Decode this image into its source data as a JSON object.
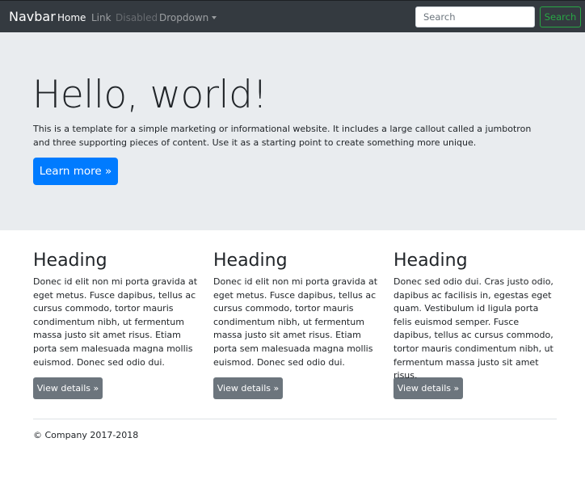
{
  "navbar": {
    "brand": "Navbar",
    "items": [
      {
        "label": "Home",
        "state": "active"
      },
      {
        "label": "Link",
        "state": "normal"
      },
      {
        "label": "Disabled",
        "state": "disabled"
      },
      {
        "label": "Dropdown",
        "state": "dropdown"
      }
    ],
    "search_placeholder": "Search",
    "search_button": "Search"
  },
  "jumbotron": {
    "title": "Hello, world!",
    "text": "This is a template for a simple marketing or informational website. It includes a large callout called a jumbotron and three supporting pieces of content. Use it as a starting point to create something more unique.",
    "button": "Learn more »"
  },
  "columns": [
    {
      "heading": "Heading",
      "text": "Donec id elit non mi porta gravida at eget metus. Fusce dapibus, tellus ac cursus commodo, tortor mauris condimentum nibh, ut fermentum massa justo sit amet risus. Etiam porta sem malesuada magna mollis euismod. Donec sed odio dui.",
      "button": "View details »"
    },
    {
      "heading": "Heading",
      "text": "Donec id elit non mi porta gravida at eget metus. Fusce dapibus, tellus ac cursus commodo, tortor mauris condimentum nibh, ut fermentum massa justo sit amet risus. Etiam porta sem malesuada magna mollis euismod. Donec sed odio dui.",
      "button": "View details »"
    },
    {
      "heading": "Heading",
      "text": "Donec sed odio dui. Cras justo odio, dapibus ac facilisis in, egestas eget quam. Vestibulum id ligula porta felis euismod semper. Fusce dapibus, tellus ac cursus commodo, tortor mauris condimentum nibh, ut fermentum massa justo sit amet risus.",
      "button": "View details »"
    }
  ],
  "footer": {
    "text": "© Company 2017-2018"
  },
  "colors": {
    "navbar_bg": "#343a40",
    "jumbotron_bg": "#e9ecef",
    "primary": "#007bff",
    "secondary": "#6c757d",
    "success": "#28a745"
  }
}
